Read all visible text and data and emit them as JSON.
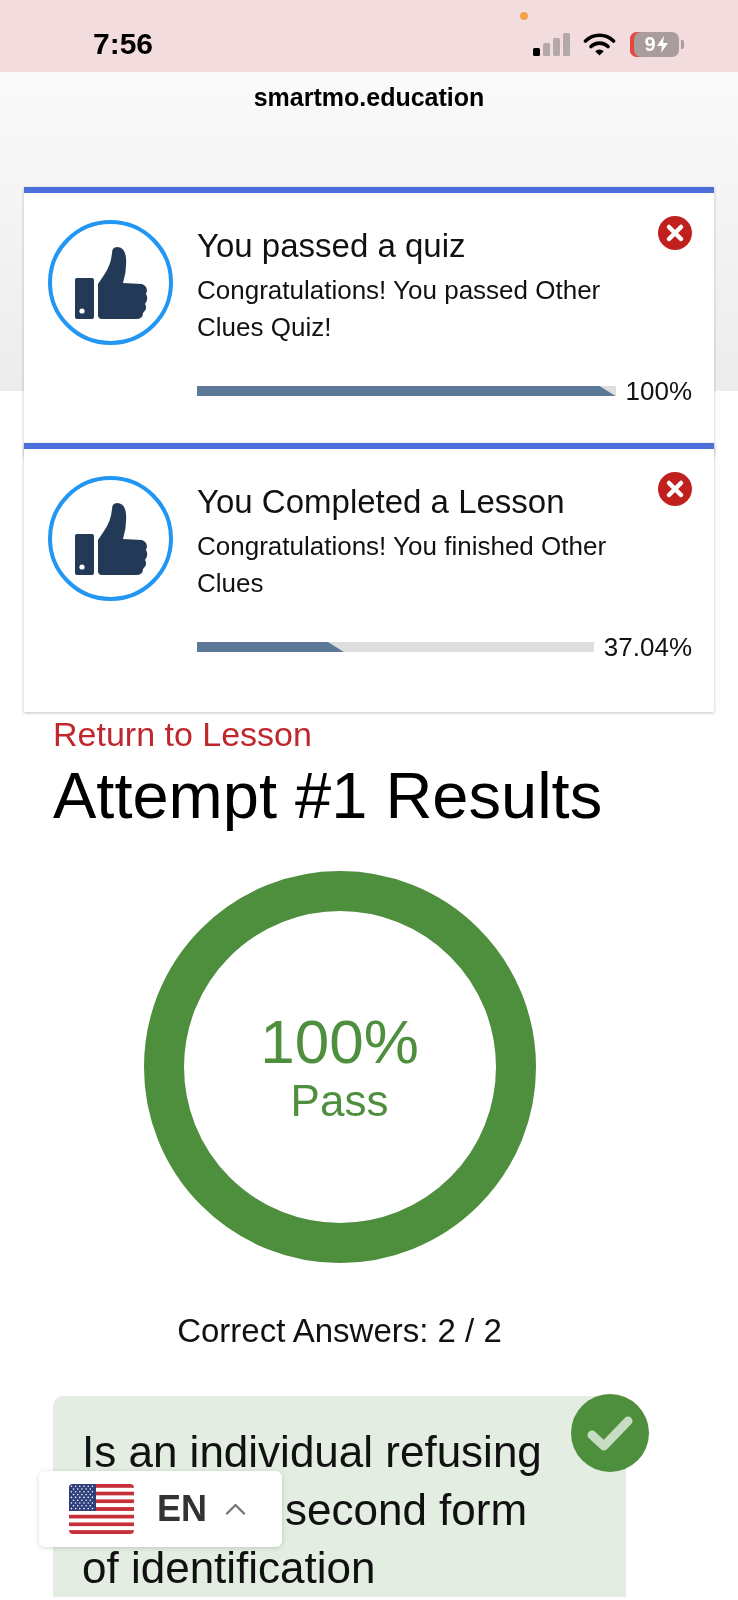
{
  "status_bar": {
    "time": "7:56",
    "battery_percent": "9",
    "charging": true
  },
  "browser": {
    "url": "smartmo.education"
  },
  "notifications": [
    {
      "title": "You passed a quiz",
      "message": "Congratulations! You passed Other Clues Quiz!",
      "level": 1,
      "percent": "100%"
    },
    {
      "title": "You Completed a Lesson",
      "message": "Congratulations! You finished Other Clues",
      "level": 0.3704,
      "percent": "37.04%"
    }
  ],
  "page": {
    "return_link": "Return to Lesson",
    "heading": "Attempt #1 Results",
    "score_ring": {
      "level": 1,
      "percent": "100%",
      "result": "Pass"
    },
    "correct_answers": "Correct Answers: 2 / 2",
    "question": {
      "correct": true,
      "lines": [
        "Is an individual refusing",
        "second form",
        "of identification"
      ]
    }
  },
  "language_selector": {
    "code": "EN"
  }
}
